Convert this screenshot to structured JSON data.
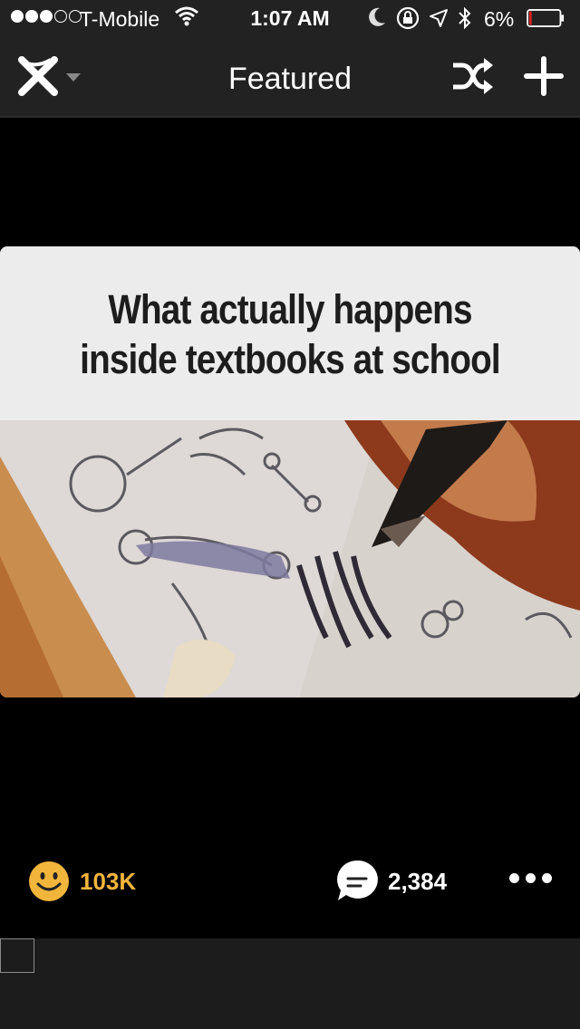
{
  "status_bar": {
    "carrier": "T-Mobile",
    "time": "1:07 AM",
    "battery_percent": "6%",
    "signal_bars_filled": 3,
    "signal_bars_total": 5,
    "battery_level": 0.06,
    "icons": [
      "wifi-icon",
      "moon-icon",
      "rotation-lock-icon",
      "location-icon",
      "bluetooth-icon",
      "battery-icon"
    ]
  },
  "nav": {
    "title": "Featured",
    "icons": [
      "app-logo-icon",
      "chevron-down-icon",
      "shuffle-icon",
      "plus-icon"
    ]
  },
  "post": {
    "caption": [
      "What actually happens",
      "inside textbooks at school"
    ]
  },
  "actions": {
    "upvotes": "103K",
    "comments": "2,384",
    "icons": [
      "smiley-icon",
      "comment-icon",
      "more-icon"
    ]
  },
  "colors": {
    "bar_background": "#222222",
    "accent_upvote": "#f2b53c",
    "battery_low": "#e02020"
  }
}
